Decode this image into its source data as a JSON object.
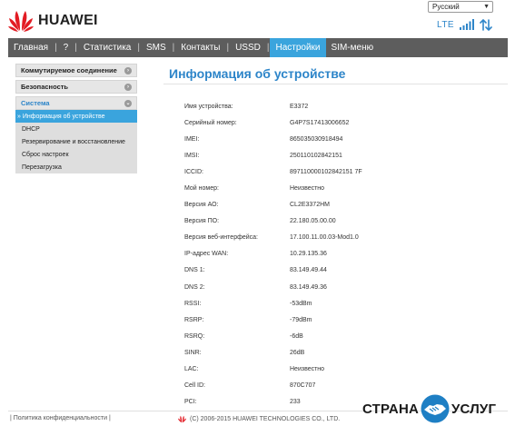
{
  "brand": {
    "name": "HUAWEI",
    "accent": "#3aa4dd",
    "logo_color": "#e21b23",
    "title_color": "#2d85c9"
  },
  "header": {
    "language": "Русский",
    "network_type": "LTE",
    "icons": [
      "signal-bars-icon",
      "data-transfer-arrows-icon"
    ]
  },
  "nav": {
    "items": [
      {
        "label": "Главная"
      },
      {
        "label": "?"
      },
      {
        "label": "Статистика"
      },
      {
        "label": "SMS"
      },
      {
        "label": "Контакты"
      },
      {
        "label": "USSD"
      },
      {
        "label": "Настройки",
        "active": true
      },
      {
        "label": "SIM-меню"
      }
    ]
  },
  "sidebar": {
    "sections": [
      {
        "label": "Коммутируемое соединение",
        "icon": "expand-circle-icon"
      },
      {
        "label": "Безопасность",
        "icon": "expand-circle-icon"
      },
      {
        "label": "Система",
        "icon": "collapse-circle-icon",
        "open": true,
        "items": [
          {
            "label": "Информация об устройстве",
            "active": true
          },
          {
            "label": "DHCP"
          },
          {
            "label": "Резервирование и восстановление"
          },
          {
            "label": "Сброс настроек"
          },
          {
            "label": "Перезагрузка"
          }
        ]
      }
    ]
  },
  "main": {
    "title": "Информация об устройстве",
    "rows": [
      {
        "label": "Имя устройства:",
        "value": "E3372"
      },
      {
        "label": "Серийный номер:",
        "value": "G4P7S17413006652"
      },
      {
        "label": "IMEI:",
        "value": "865035030918494"
      },
      {
        "label": "IMSI:",
        "value": "250110102842151"
      },
      {
        "label": "ICCID:",
        "value": "897110000102842151 7F"
      },
      {
        "label": "Мой номер:",
        "value": "Неизвестно"
      },
      {
        "label": "Версия АО:",
        "value": "CL2E3372HM"
      },
      {
        "label": "Версия ПО:",
        "value": "22.180.05.00.00"
      },
      {
        "label": "Версия веб-интерфейса:",
        "value": "17.100.11.00.03-Mod1.0"
      },
      {
        "label": "IP-адрес WAN:",
        "value": "10.29.135.36"
      },
      {
        "label": "DNS 1:",
        "value": "83.149.49.44"
      },
      {
        "label": "DNS 2:",
        "value": "83.149.49.36"
      },
      {
        "label": "RSSI:",
        "value": "-53dBm"
      },
      {
        "label": "RSRP:",
        "value": "-79dBm"
      },
      {
        "label": "RSRQ:",
        "value": "-6dB"
      },
      {
        "label": "SINR:",
        "value": "26dB"
      },
      {
        "label": "LAC:",
        "value": "Неизвестно"
      },
      {
        "label": "Cell ID:",
        "value": "870C707"
      },
      {
        "label": "PCI:",
        "value": "233"
      }
    ]
  },
  "footer": {
    "privacy_link": "Политика конфиденциальности",
    "copyright": "(C) 2006-2015 HUAWEI TECHNOLOGIES CO., LTD."
  },
  "watermark": {
    "left_text": "СТРАНА",
    "right_text": "УСЛУГ",
    "circle_color": "#1e7fc4"
  }
}
